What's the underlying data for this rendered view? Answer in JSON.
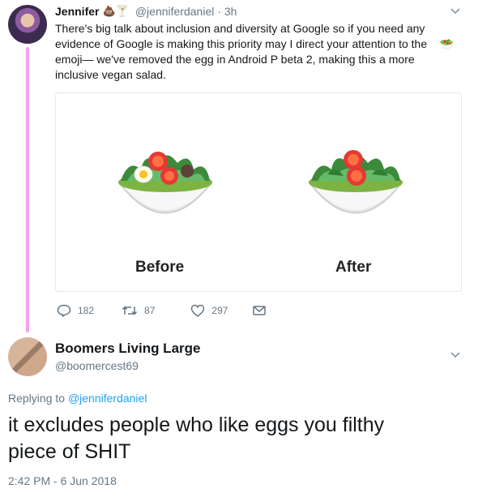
{
  "tweet1": {
    "name": "Jennifer",
    "name_emojis": "💩🍸",
    "handle": "@jenniferdaniel",
    "time": "· 3h",
    "text_line1": "There's big talk about inclusion and diversity at Google so if you need any",
    "text_line2": "evidence of Google is making this priority may I direct your attention to the",
    "text_line2_emoji": "🥗",
    "text_line3": "emoji— we've removed the egg in Android P beta 2, making this a more",
    "text_line4": "inclusive vegan salad.",
    "card": {
      "before_label": "Before",
      "after_label": "After"
    },
    "actions": {
      "replies": "182",
      "retweets": "87",
      "likes": "297"
    }
  },
  "tweet2": {
    "name": "Boomers Living Large",
    "handle": "@boomercest69",
    "replying_prefix": "Replying to ",
    "replying_to": "@jenniferdaniel",
    "text": "it excludes people who like eggs you filthy piece of SHIT",
    "text_line1": "it excludes people who like eggs you filthy",
    "text_line2": "piece of SHIT",
    "timestamp": "2:42 PM - 6 Jun 2018"
  },
  "colors": {
    "accent": "#1da1f2",
    "thread_line": "#f5a3e8",
    "secondary_text": "#657786"
  }
}
